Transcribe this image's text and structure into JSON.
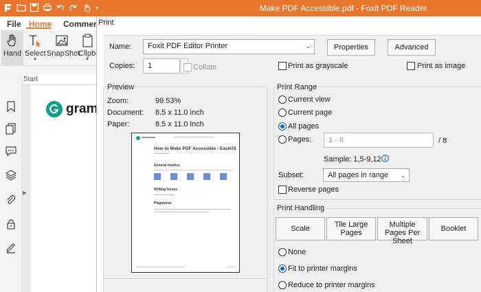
{
  "window": {
    "title": "Make PDF Accessible.pdf - Foxit PDF Reader"
  },
  "ribbon": {
    "tabs": [
      "File",
      "Home",
      "Comment"
    ],
    "buttons": [
      "Hand",
      "Select",
      "SnapShot",
      "Clipbo"
    ]
  },
  "document": {
    "start_tab": "Start",
    "logo_text": "gramm"
  },
  "dialog": {
    "title": "Print",
    "name_label": "Name:",
    "printer_name": "Foxit PDF Editor Printer",
    "properties_label": "Properties",
    "advanced_label": "Advanced",
    "copies_label": "Copies:",
    "copies_value": "1",
    "collate_label": "Collate",
    "grayscale_label": "Print as grayscale",
    "image_label": "Print as image",
    "preview": {
      "title": "Preview",
      "zoom_label": "Zoom:",
      "zoom_value": "99.53%",
      "document_label": "Document:",
      "document_value": "8.5 x 11.0 inch",
      "paper_label": "Paper:",
      "paper_value": "8.5 x 11.0 inch",
      "page_heading": "How to Make PDF Accessible - EaseUS",
      "page_section1": "General metrics",
      "page_section2": "Writing Issues",
      "page_section3": "Plagiarism"
    },
    "print_range": {
      "title": "Print Range",
      "options": [
        "Current view",
        "Current page",
        "All pages",
        "Pages:"
      ],
      "selected": "All pages",
      "pages_placeholder": "1 - 8",
      "total_pages": "/ 8",
      "sample": "Sample: 1,5-9,12",
      "info_icon": "info-icon",
      "subset_label": "Subset:",
      "subset_value": "All pages in range",
      "reverse_label": "Reverse pages"
    },
    "print_handling": {
      "title": "Print Handling",
      "tabs": [
        "Scale",
        "Tile Large Pages",
        "Multiple Pages Per Sheet",
        "Booklet"
      ],
      "options": [
        "None",
        "Fit to printer margins",
        "Reduce to printer margins"
      ],
      "selected": "Fit to printer margins"
    }
  },
  "colors": {
    "accent": "#e8762c",
    "radio": "#1a5fc7",
    "logo": "#15a085"
  }
}
